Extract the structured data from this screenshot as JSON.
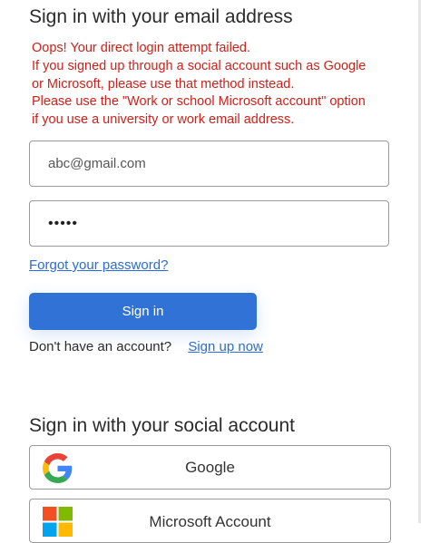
{
  "email_section": {
    "heading": "Sign in with your email address",
    "error_lines": [
      "Oops! Your direct login attempt failed.",
      "If you signed up through a social account such as Google",
      "or Microsoft, please use that method instead.",
      "Please use the \"Work or school Microsoft account\" option",
      "if you use a university or work email address."
    ],
    "email_value": "abc@gmail.com",
    "password_value": "•••••",
    "forgot_link": "Forgot your password?",
    "signin_label": "Sign in",
    "no_account_text": "Don't have an account?",
    "signup_link": "Sign up now"
  },
  "social_section": {
    "heading": "Sign in with your social account",
    "google_label": "Google",
    "google_icon": "google-g-icon",
    "microsoft_label": "Microsoft Account",
    "microsoft_icon": "microsoft-logo-icon"
  },
  "colors": {
    "error": "#d0201a",
    "link": "#2b6cd8",
    "primary_button": "#3172d6"
  }
}
